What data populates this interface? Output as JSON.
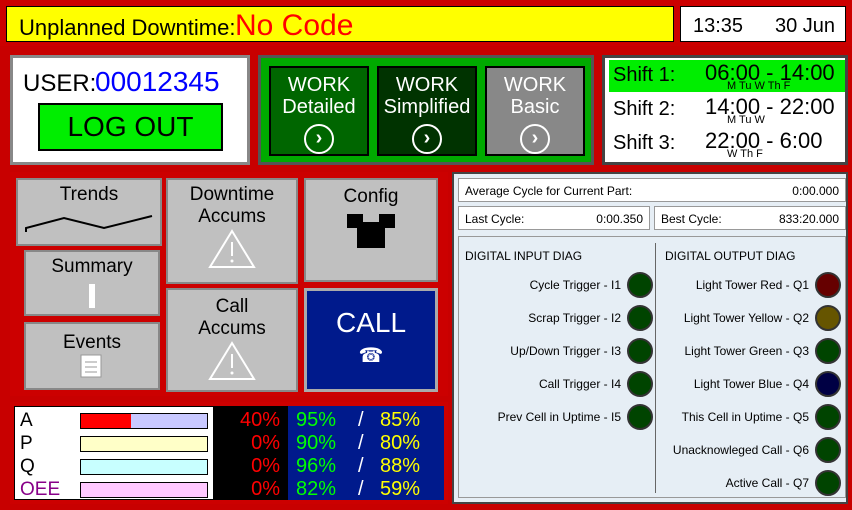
{
  "header": {
    "label": "Unplanned Downtime:",
    "code": "No Code",
    "time": "13:35",
    "date": "30 Jun"
  },
  "user": {
    "label": "USER:",
    "id": "00012345",
    "logout": "LOG OUT"
  },
  "work": [
    {
      "line1": "WORK",
      "line2": "Detailed",
      "color": "#006600"
    },
    {
      "line1": "WORK",
      "line2": "Simplified",
      "color": "#003300"
    },
    {
      "line1": "WORK",
      "line2": "Basic",
      "color": "#888888"
    }
  ],
  "shifts": [
    {
      "name": "Shift 1:",
      "range": "06:00 - 14:00",
      "days": "M Tu W Th F",
      "highlight": "#00ee00"
    },
    {
      "name": "Shift 2:",
      "range": "14:00 - 22:00",
      "days": "M Tu W",
      "highlight": "#ffffff"
    },
    {
      "name": "Shift 3:",
      "range": "22:00 - 6:00",
      "days": "W Th F",
      "highlight": "#ffffff"
    }
  ],
  "grid": {
    "trends": "Trends",
    "summary": "Summary",
    "events": "Events",
    "downtime_accums": "Downtime Accums",
    "call_accums": "Call Accums",
    "config": "Config",
    "call": "CALL"
  },
  "diag": {
    "avg_cycle_label": "Average Cycle for Current Part:",
    "avg_cycle_value": "0:00.000",
    "last_cycle_label": "Last Cycle:",
    "last_cycle_value": "0:00.350",
    "best_cycle_label": "Best Cycle:",
    "best_cycle_value": "833:20.000",
    "input_header": "DIGITAL INPUT DIAG",
    "output_header": "DIGITAL OUTPUT DIAG",
    "inputs": [
      {
        "label": "Cycle Trigger - I1",
        "color": "#004400"
      },
      {
        "label": "Scrap Trigger - I2",
        "color": "#004400"
      },
      {
        "label": "Up/Down Trigger - I3",
        "color": "#004400"
      },
      {
        "label": "Call Trigger - I4",
        "color": "#004400"
      },
      {
        "label": "Prev Cell in Uptime - I5",
        "color": "#004400"
      }
    ],
    "outputs": [
      {
        "label": "Light Tower Red - Q1",
        "color": "#660000"
      },
      {
        "label": "Light Tower Yellow - Q2",
        "color": "#665500"
      },
      {
        "label": "Light Tower Green - Q3",
        "color": "#004400"
      },
      {
        "label": "Light Tower Blue - Q4",
        "color": "#000044"
      },
      {
        "label": "This Cell in Uptime - Q5",
        "color": "#004400"
      },
      {
        "label": "Unacknowleged Call - Q6",
        "color": "#004400"
      },
      {
        "label": "Active Call - Q7",
        "color": "#004400"
      }
    ]
  },
  "oee": [
    {
      "label": "A",
      "level": 0.4,
      "bar_color": "#ff0000",
      "bg_color": "#c8c8ff",
      "pct": "40%",
      "v1": "95%",
      "v2": "85%",
      "label_color": "#000000"
    },
    {
      "label": "P",
      "level": 0,
      "bar_color": "#ff0000",
      "bg_color": "#ffffc8",
      "pct": "0%",
      "v1": "90%",
      "v2": "80%",
      "label_color": "#000000"
    },
    {
      "label": "Q",
      "level": 0,
      "bar_color": "#ff0000",
      "bg_color": "#c8ffff",
      "pct": "0%",
      "v1": "96%",
      "v2": "88%",
      "label_color": "#000000"
    },
    {
      "label": "OEE",
      "level": 0,
      "bar_color": "#ff0000",
      "bg_color": "#ffc8ff",
      "pct": "0%",
      "v1": "82%",
      "v2": "59%",
      "label_color": "#880088"
    }
  ]
}
